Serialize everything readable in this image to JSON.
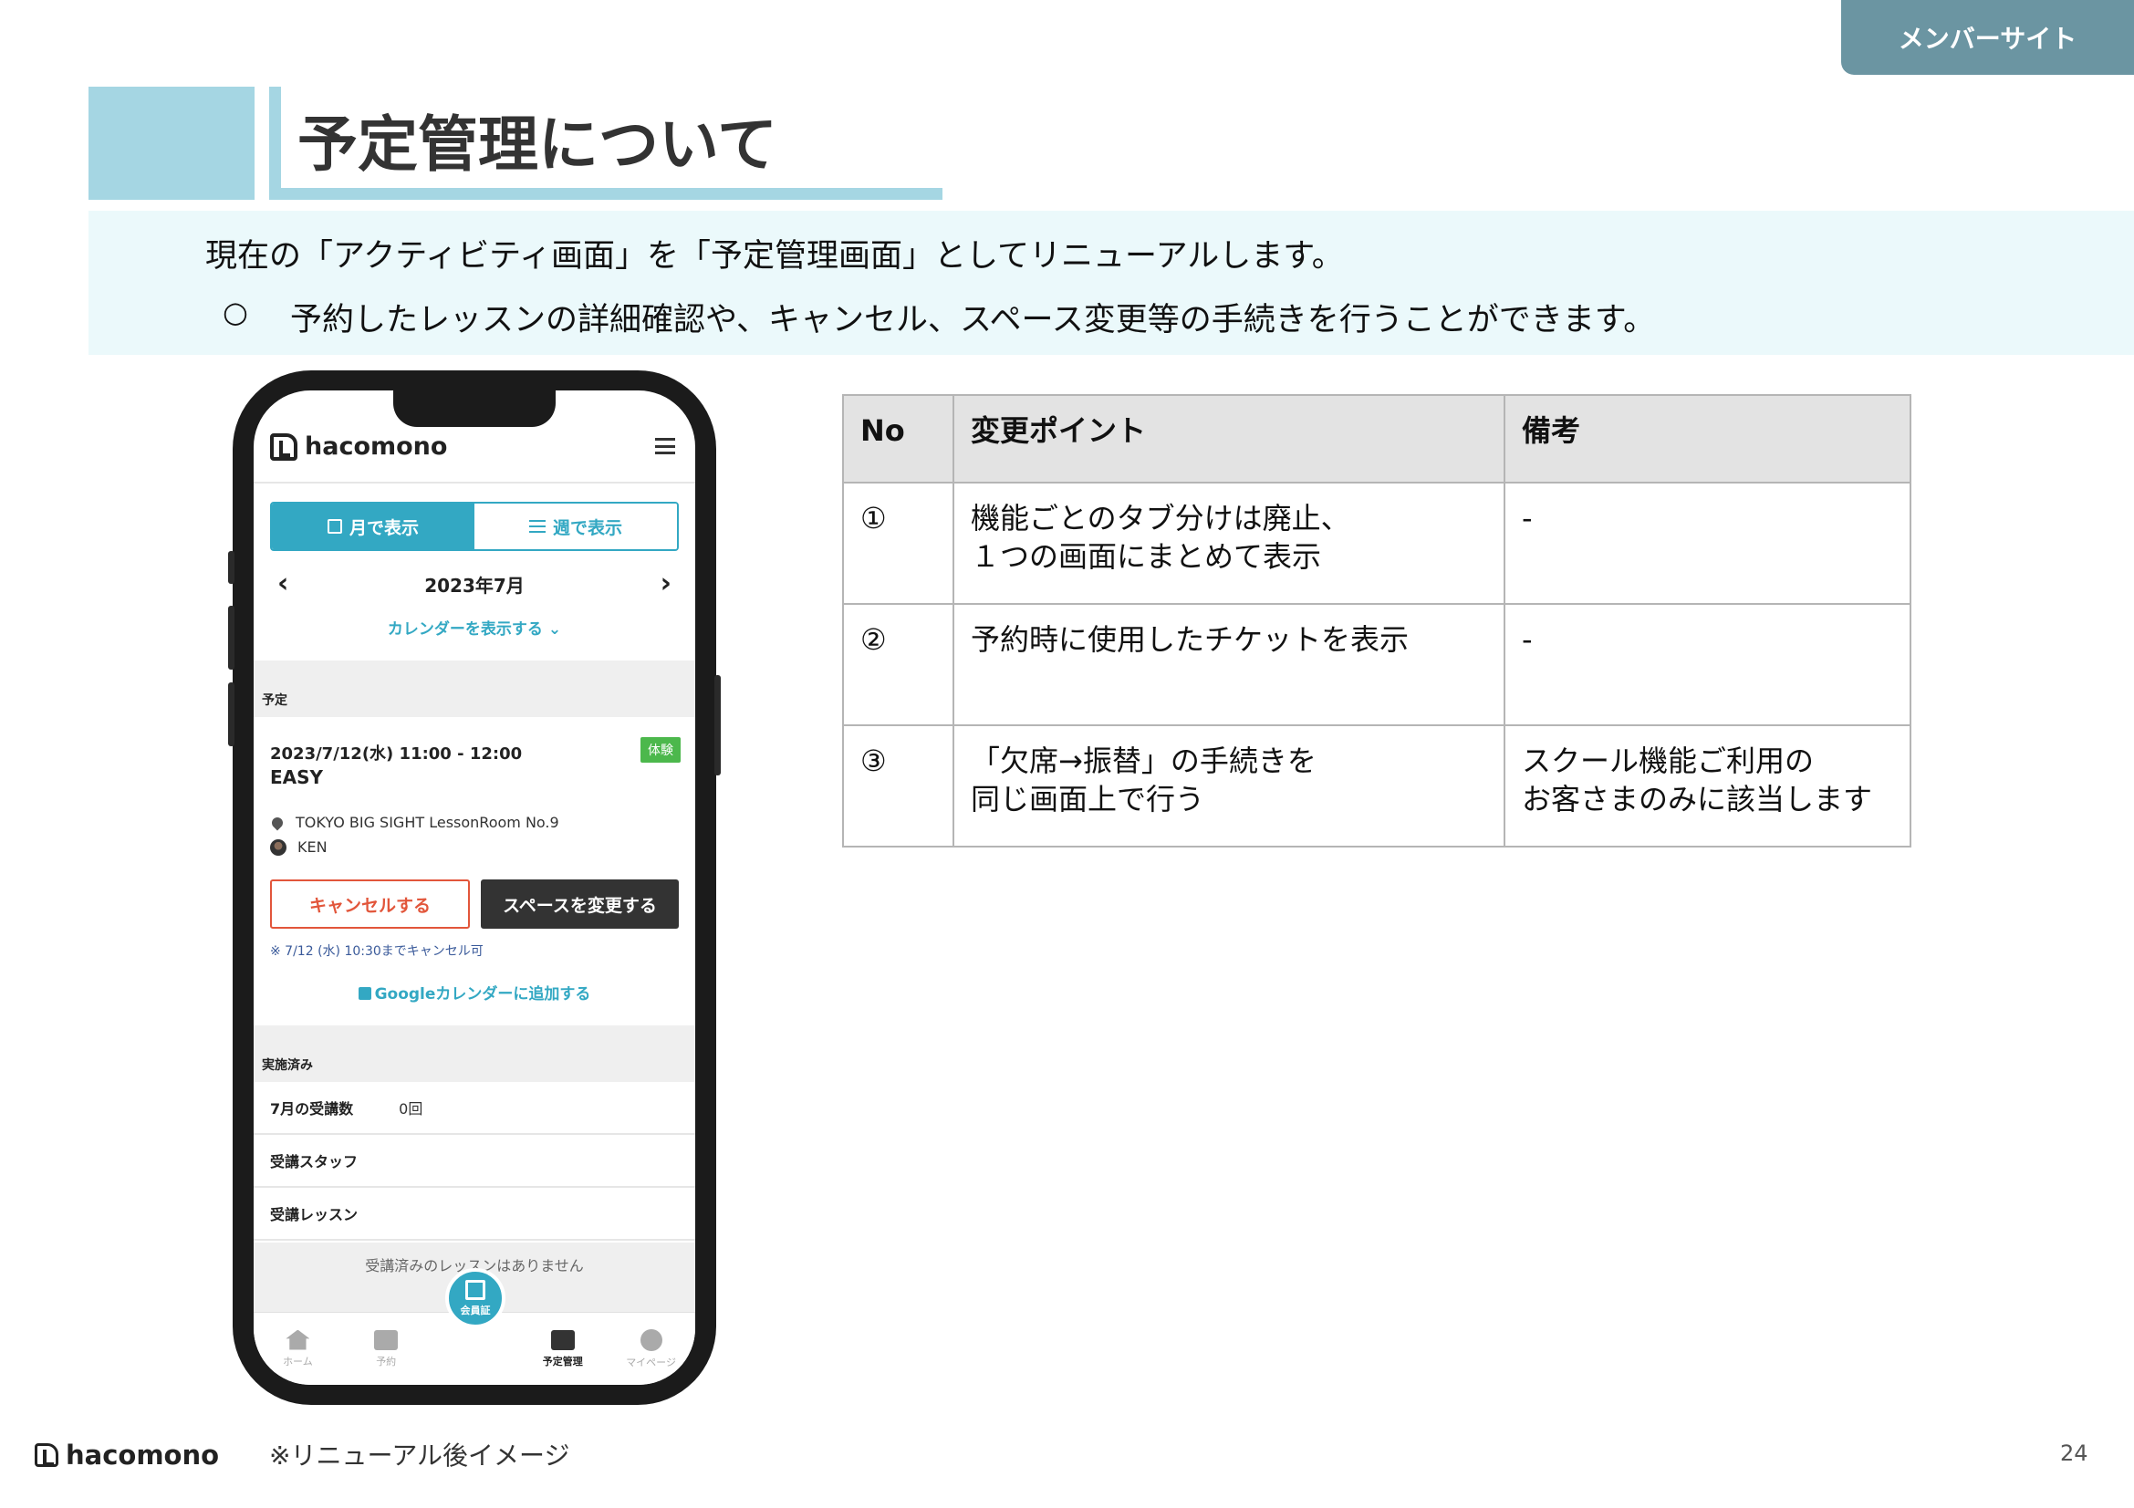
{
  "header": {
    "member_site": "メンバーサイト",
    "title": "予定管理について"
  },
  "intro": {
    "line1": "現在の「アクティビティ画面」を「予定管理画面」としてリニューアルします。",
    "bullet": "○",
    "line2": "予約したレッスンの詳細確認や、キャンセル、スペース変更等の手続きを行うことができます。"
  },
  "phone": {
    "brand": "hacomono",
    "view_toggle": {
      "month": "月で表示",
      "week": "週で表示"
    },
    "month_label": "2023年7月",
    "prev": "‹",
    "next": "›",
    "show_calendar": "カレンダーを表示する ⌄",
    "section_upcoming": "予定",
    "event": {
      "time": "2023/7/12(水) 11:00 - 12:00",
      "name": "EASY",
      "badge": "体験",
      "location": "TOKYO BIG SIGHT  LessonRoom  No.9",
      "staff": "KEN"
    },
    "buttons": {
      "cancel": "キャンセルする",
      "change_space": "スペースを変更する"
    },
    "cancel_note": "※ 7/12 (水) 10:30までキャンセル可",
    "google_calendar": "Googleカレンダーに追加する",
    "section_done": "実施済み",
    "stats": {
      "count_label": "7月の受講数",
      "count_value": "0回",
      "staff_label": "受講スタッフ",
      "lesson_label": "受講レッスン"
    },
    "empty_message": "受講済みのレッスンはありません",
    "tabbar": {
      "home": "ホーム",
      "reserve": "予約",
      "member_card": "会員証",
      "schedule": "予定管理",
      "mypage": "マイページ"
    }
  },
  "table": {
    "headers": {
      "no": "No",
      "point": "変更ポイント",
      "note": "備考"
    },
    "rows": [
      {
        "no": "①",
        "point_l1": "機能ごとのタブ分けは廃止、",
        "point_l2": "１つの画面にまとめて表示",
        "note_l1": "-",
        "note_l2": ""
      },
      {
        "no": "②",
        "point_l1": "予約時に使用したチケットを表示",
        "point_l2": "",
        "note_l1": "-",
        "note_l2": ""
      },
      {
        "no": "③",
        "point_l1": "「欠席→振替」の手続きを",
        "point_l2": "同じ画面上で行う",
        "note_l1": "スクール機能ご利用の",
        "note_l2": "お客さまのみに該当します"
      }
    ]
  },
  "footer": {
    "brand": "hacomono",
    "note": "※リニューアル後イメージ",
    "page": "24"
  },
  "colors": {
    "accent": "#33a8c3",
    "title_bar": "#a5d6e3",
    "member_tab": "#6b95a2",
    "cancel": "#e2563b",
    "note_red": "#cc0000"
  }
}
